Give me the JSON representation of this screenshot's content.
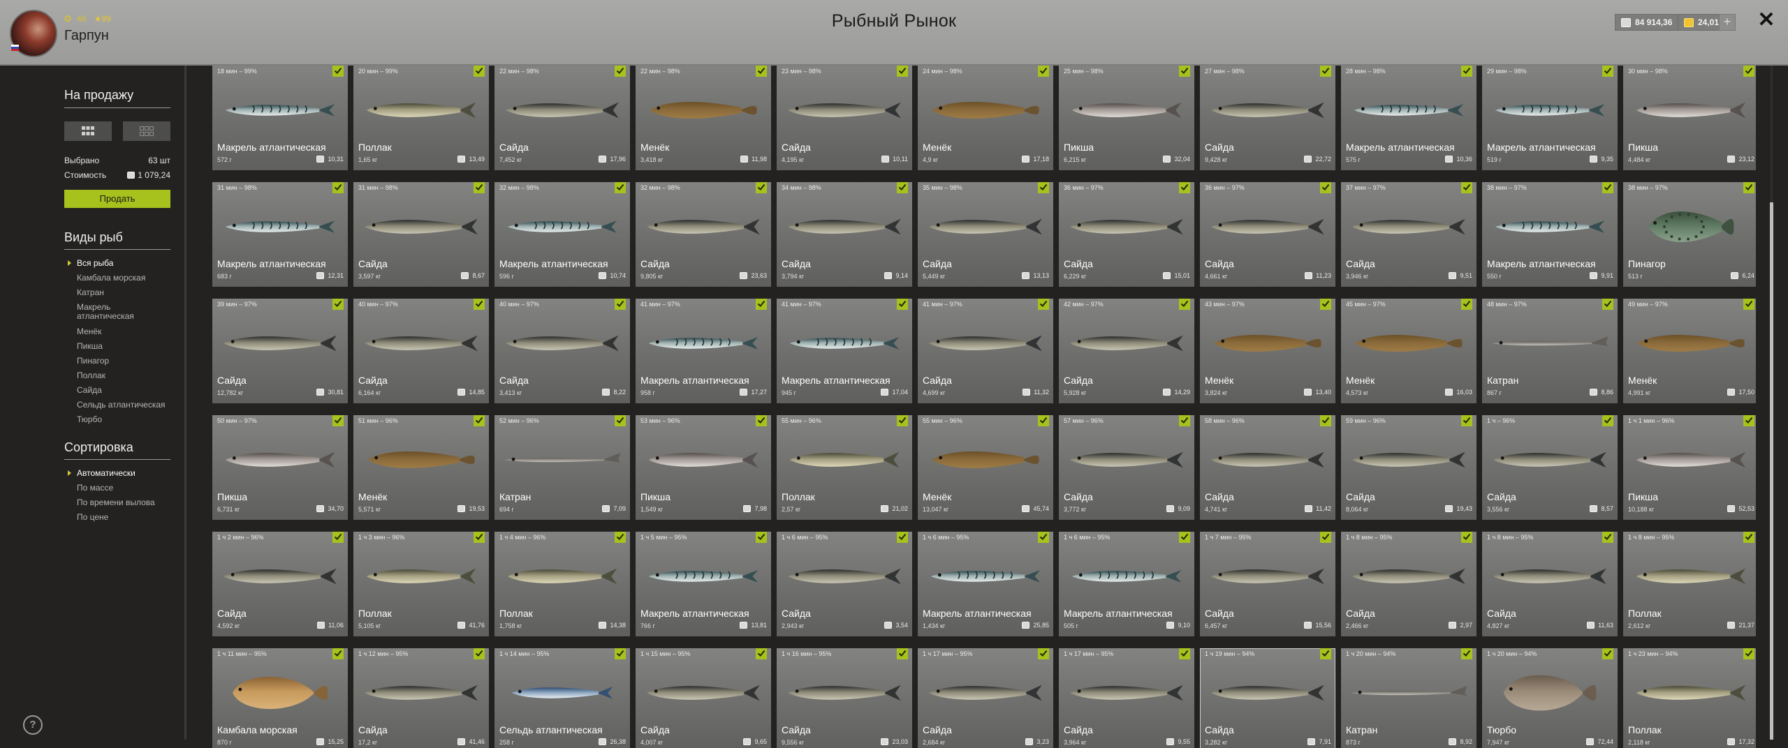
{
  "header": {
    "title": "Рыбный Рынок",
    "player": {
      "name": "Гарпун",
      "level": "46",
      "rank": "99"
    },
    "money": "84 914,36",
    "gold": "24,01",
    "add_label": "+",
    "close_label": "✕"
  },
  "sidebar": {
    "for_sale_title": "На продажу",
    "selected_label": "Выбрано",
    "selected_value": "63 шт",
    "cost_label": "Стоимость",
    "cost_value": "1 079,24",
    "sell_label": "Продать",
    "fish_types_title": "Виды рыб",
    "fish_types": [
      "Вся рыба",
      "Камбала морская",
      "Катран",
      "Макрель атлантическая",
      "Менёк",
      "Пикша",
      "Пинагор",
      "Поллак",
      "Сайда",
      "Сельдь атлантическая",
      "Тюрбо"
    ],
    "sorting_title": "Сортировка",
    "sorting": [
      "Автоматически",
      "По массе",
      "По времени вылова",
      "По цене"
    ],
    "help_label": "?"
  },
  "tiles": [
    {
      "time": "18 мин – 99%",
      "name": "Макрель атлантическая",
      "weight": "572 г",
      "price": "10,31",
      "kind": "mackerel"
    },
    {
      "time": "20 мин – 99%",
      "name": "Поллак",
      "weight": "1,65 кг",
      "price": "13,49",
      "kind": "pollock"
    },
    {
      "time": "22 мин – 98%",
      "name": "Сайда",
      "weight": "7,452 кг",
      "price": "17,96",
      "kind": "saithe"
    },
    {
      "time": "22 мин – 98%",
      "name": "Менёк",
      "weight": "3,418 кг",
      "price": "11,98",
      "kind": "tusk"
    },
    {
      "time": "23 мин – 98%",
      "name": "Сайда",
      "weight": "4,195 кг",
      "price": "10,11",
      "kind": "saithe"
    },
    {
      "time": "24 мин – 98%",
      "name": "Менёк",
      "weight": "4,9 кг",
      "price": "17,18",
      "kind": "tusk"
    },
    {
      "time": "25 мин – 98%",
      "name": "Пикша",
      "weight": "6,215 кг",
      "price": "32,04",
      "kind": "haddock"
    },
    {
      "time": "27 мин – 98%",
      "name": "Сайда",
      "weight": "9,428 кг",
      "price": "22,72",
      "kind": "saithe"
    },
    {
      "time": "28 мин – 98%",
      "name": "Макрель атлантическая",
      "weight": "575 г",
      "price": "10,36",
      "kind": "mackerel"
    },
    {
      "time": "29 мин – 98%",
      "name": "Макрель атлантическая",
      "weight": "519 г",
      "price": "9,35",
      "kind": "mackerel"
    },
    {
      "time": "30 мин – 98%",
      "name": "Пикша",
      "weight": "4,484 кг",
      "price": "23,12",
      "kind": "haddock"
    },
    {
      "time": "31 мин – 98%",
      "name": "Макрель атлантическая",
      "weight": "683 г",
      "price": "12,31",
      "kind": "mackerel"
    },
    {
      "time": "31 мин – 98%",
      "name": "Сайда",
      "weight": "3,597 кг",
      "price": "8,67",
      "kind": "saithe"
    },
    {
      "time": "32 мин – 98%",
      "name": "Макрель атлантическая",
      "weight": "596 г",
      "price": "10,74",
      "kind": "mackerel"
    },
    {
      "time": "32 мин – 98%",
      "name": "Сайда",
      "weight": "9,805 кг",
      "price": "23,63",
      "kind": "saithe"
    },
    {
      "time": "34 мин – 98%",
      "name": "Сайда",
      "weight": "3,794 кг",
      "price": "9,14",
      "kind": "saithe"
    },
    {
      "time": "35 мин – 98%",
      "name": "Сайда",
      "weight": "5,449 кг",
      "price": "13,13",
      "kind": "saithe"
    },
    {
      "time": "36 мин – 97%",
      "name": "Сайда",
      "weight": "6,229 кг",
      "price": "15,01",
      "kind": "saithe"
    },
    {
      "time": "36 мин – 97%",
      "name": "Сайда",
      "weight": "4,661 кг",
      "price": "11,23",
      "kind": "saithe"
    },
    {
      "time": "37 мин – 97%",
      "name": "Сайда",
      "weight": "3,946 кг",
      "price": "9,51",
      "kind": "saithe"
    },
    {
      "time": "38 мин – 97%",
      "name": "Макрель атлантическая",
      "weight": "550 г",
      "price": "9,91",
      "kind": "mackerel"
    },
    {
      "time": "38 мин – 97%",
      "name": "Пинагор",
      "weight": "513 г",
      "price": "6,24",
      "kind": "lumpfish"
    },
    {
      "time": "39 мин – 97%",
      "name": "Сайда",
      "weight": "12,782 кг",
      "price": "30,81",
      "kind": "saithe"
    },
    {
      "time": "40 мин – 97%",
      "name": "Сайда",
      "weight": "6,164 кг",
      "price": "14,85",
      "kind": "saithe"
    },
    {
      "time": "40 мин – 97%",
      "name": "Сайда",
      "weight": "3,413 кг",
      "price": "8,22",
      "kind": "saithe"
    },
    {
      "time": "41 мин – 97%",
      "name": "Макрель атлантическая",
      "weight": "958 г",
      "price": "17,27",
      "kind": "mackerel"
    },
    {
      "time": "41 мин – 97%",
      "name": "Макрель атлантическая",
      "weight": "945 г",
      "price": "17,04",
      "kind": "mackerel"
    },
    {
      "time": "41 мин – 97%",
      "name": "Сайда",
      "weight": "4,699 кг",
      "price": "11,32",
      "kind": "saithe"
    },
    {
      "time": "42 мин – 97%",
      "name": "Сайда",
      "weight": "5,928 кг",
      "price": "14,29",
      "kind": "saithe"
    },
    {
      "time": "43 мин – 97%",
      "name": "Менёк",
      "weight": "3,824 кг",
      "price": "13,40",
      "kind": "tusk"
    },
    {
      "time": "45 мин – 97%",
      "name": "Менёк",
      "weight": "4,573 кг",
      "price": "16,03",
      "kind": "tusk"
    },
    {
      "time": "48 мин – 97%",
      "name": "Катран",
      "weight": "867 г",
      "price": "8,86",
      "kind": "dogfish"
    },
    {
      "time": "49 мин – 97%",
      "name": "Менёк",
      "weight": "4,991 кг",
      "price": "17,50",
      "kind": "tusk"
    },
    {
      "time": "50 мин – 97%",
      "name": "Пикша",
      "weight": "6,731 кг",
      "price": "34,70",
      "kind": "haddock"
    },
    {
      "time": "51 мин – 96%",
      "name": "Менёк",
      "weight": "5,571 кг",
      "price": "19,53",
      "kind": "tusk"
    },
    {
      "time": "52 мин – 96%",
      "name": "Катран",
      "weight": "694 г",
      "price": "7,09",
      "kind": "dogfish"
    },
    {
      "time": "53 мин – 96%",
      "name": "Пикша",
      "weight": "1,549 кг",
      "price": "7,98",
      "kind": "haddock"
    },
    {
      "time": "55 мин – 96%",
      "name": "Поллак",
      "weight": "2,57 кг",
      "price": "21,02",
      "kind": "pollock"
    },
    {
      "time": "55 мин – 96%",
      "name": "Менёк",
      "weight": "13,047 кг",
      "price": "45,74",
      "kind": "tusk"
    },
    {
      "time": "57 мин – 96%",
      "name": "Сайда",
      "weight": "3,772 кг",
      "price": "9,09",
      "kind": "saithe"
    },
    {
      "time": "58 мин – 96%",
      "name": "Сайда",
      "weight": "4,741 кг",
      "price": "11,42",
      "kind": "saithe"
    },
    {
      "time": "59 мин – 96%",
      "name": "Сайда",
      "weight": "8,064 кг",
      "price": "19,43",
      "kind": "saithe"
    },
    {
      "time": "1 ч – 96%",
      "name": "Сайда",
      "weight": "3,556 кг",
      "price": "8,57",
      "kind": "saithe"
    },
    {
      "time": "1 ч 1 мин – 96%",
      "name": "Пикша",
      "weight": "10,188 кг",
      "price": "52,53",
      "kind": "haddock"
    },
    {
      "time": "1 ч 2 мин – 96%",
      "name": "Сайда",
      "weight": "4,592 кг",
      "price": "11,06",
      "kind": "saithe"
    },
    {
      "time": "1 ч 3 мин – 96%",
      "name": "Поллак",
      "weight": "5,105 кг",
      "price": "41,76",
      "kind": "pollock"
    },
    {
      "time": "1 ч 4 мин – 96%",
      "name": "Поллак",
      "weight": "1,758 кг",
      "price": "14,38",
      "kind": "pollock"
    },
    {
      "time": "1 ч 5 мин – 95%",
      "name": "Макрель атлантическая",
      "weight": "766 г",
      "price": "13,81",
      "kind": "mackerel"
    },
    {
      "time": "1 ч 6 мин – 95%",
      "name": "Сайда",
      "weight": "2,943 кг",
      "price": "3,54",
      "kind": "saithe"
    },
    {
      "time": "1 ч 6 мин – 95%",
      "name": "Макрель атлантическая",
      "weight": "1,434 кг",
      "price": "25,85",
      "kind": "mackerel"
    },
    {
      "time": "1 ч 6 мин – 95%",
      "name": "Макрель атлантическая",
      "weight": "505 г",
      "price": "9,10",
      "kind": "mackerel"
    },
    {
      "time": "1 ч 7 мин – 95%",
      "name": "Сайда",
      "weight": "6,457 кг",
      "price": "15,56",
      "kind": "saithe"
    },
    {
      "time": "1 ч 8 мин – 95%",
      "name": "Сайда",
      "weight": "2,466 кг",
      "price": "2,97",
      "kind": "saithe"
    },
    {
      "time": "1 ч 8 мин – 95%",
      "name": "Сайда",
      "weight": "4,827 кг",
      "price": "11,63",
      "kind": "saithe"
    },
    {
      "time": "1 ч 8 мин – 95%",
      "name": "Поллак",
      "weight": "2,612 кг",
      "price": "21,37",
      "kind": "pollock"
    },
    {
      "time": "1 ч 11 мин – 95%",
      "name": "Камбала морская",
      "weight": "870 г",
      "price": "15,25",
      "kind": "plaice"
    },
    {
      "time": "1 ч 12 мин – 95%",
      "name": "Сайда",
      "weight": "17,2 кг",
      "price": "41,46",
      "kind": "saithe"
    },
    {
      "time": "1 ч 14 мин – 95%",
      "name": "Сельдь атлантическая",
      "weight": "258 г",
      "price": "26,38",
      "kind": "herring"
    },
    {
      "time": "1 ч 15 мин – 95%",
      "name": "Сайда",
      "weight": "4,007 кг",
      "price": "9,65",
      "kind": "saithe"
    },
    {
      "time": "1 ч 16 мин – 95%",
      "name": "Сайда",
      "weight": "9,556 кг",
      "price": "23,03",
      "kind": "saithe"
    },
    {
      "time": "1 ч 17 мин – 95%",
      "name": "Сайда",
      "weight": "2,684 кг",
      "price": "3,23",
      "kind": "saithe"
    },
    {
      "time": "1 ч 17 мин – 95%",
      "name": "Сайда",
      "weight": "3,964 кг",
      "price": "9,55",
      "kind": "saithe"
    },
    {
      "time": "1 ч 19 мин – 94%",
      "name": "Сайда",
      "weight": "3,282 кг",
      "price": "7,91",
      "kind": "saithe",
      "selected": true
    },
    {
      "time": "1 ч 20 мин – 94%",
      "name": "Катран",
      "weight": "873 г",
      "price": "8,92",
      "kind": "dogfish"
    },
    {
      "time": "1 ч 20 мин – 94%",
      "name": "Тюрбо",
      "weight": "7,947 кг",
      "price": "72,44",
      "kind": "turbot"
    },
    {
      "time": "1 ч 23 мин – 94%",
      "name": "Поллак",
      "weight": "2,118 кг",
      "price": "17,32",
      "kind": "pollock"
    }
  ]
}
